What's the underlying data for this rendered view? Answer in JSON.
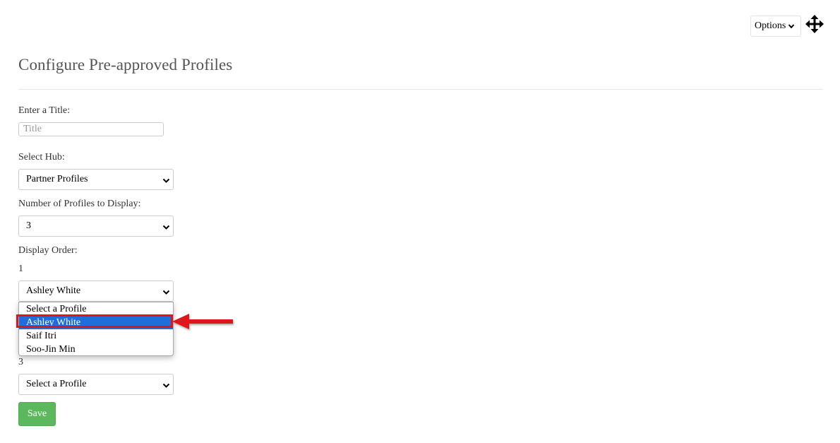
{
  "toolbar": {
    "options_label": "Options",
    "options_icon": "chevron-down-icon",
    "move_icon": "move-arrows-icon"
  },
  "page": {
    "title": "Configure Pre-approved Profiles"
  },
  "form": {
    "title_label": "Enter a Title:",
    "title_value": "",
    "title_placeholder": "Title",
    "hub_label": "Select Hub:",
    "hub_value": "Partner Profiles",
    "count_label": "Number of Profiles to Display:",
    "count_value": "3",
    "order_label": "Display Order:",
    "slots": [
      {
        "number": "1",
        "value": "Ashley White"
      },
      {
        "number": "3",
        "value": "Select a Profile"
      }
    ],
    "profile_options": [
      "Select a Profile",
      "Ashley White",
      "Saif Itri",
      "Soo-Jin Min"
    ],
    "selected_option": "Ashley White",
    "save_label": "Save"
  },
  "annotation": {
    "highlight_color": "#e0141e"
  },
  "colors": {
    "save_button": "#5cb85c",
    "selected_option_bg": "#1e6fd9"
  }
}
